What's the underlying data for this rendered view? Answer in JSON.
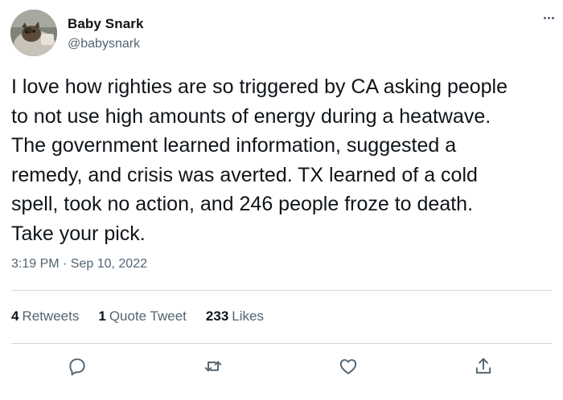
{
  "user": {
    "display_name": "Baby Snark",
    "handle": "@babysnark"
  },
  "tweet": {
    "text_lines": [
      "I love how righties are so triggered by CA asking people",
      "to not use high amounts of energy during a heatwave.",
      "The government learned information, suggested a",
      "remedy, and crisis was averted. TX learned of a cold",
      "spell, took no action, and 246 people froze to death.",
      "Take your pick."
    ],
    "timestamp": "3:19 PM · Sep 10, 2022"
  },
  "stats": {
    "retweets": {
      "count": "4",
      "label": "Retweets"
    },
    "quote_tweets": {
      "count": "1",
      "label": "Quote Tweet"
    },
    "likes": {
      "count": "233",
      "label": "Likes"
    }
  },
  "actions": [
    {
      "icon": "reply-icon"
    },
    {
      "icon": "retweet-icon"
    },
    {
      "icon": "like-icon"
    },
    {
      "icon": "share-icon"
    }
  ],
  "colors": {
    "text_primary": "#0f1419",
    "text_secondary": "#536471",
    "divider": "#cfd9de"
  }
}
